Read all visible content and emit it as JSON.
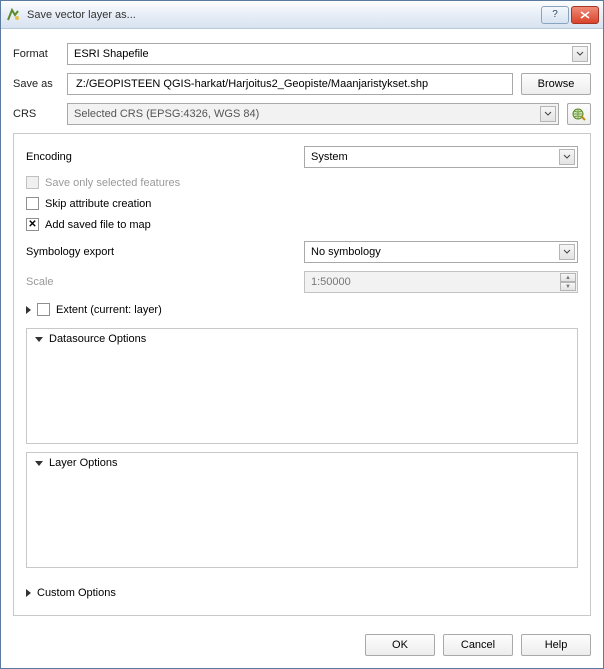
{
  "window": {
    "title": "Save vector layer as..."
  },
  "labels": {
    "format": "Format",
    "saveas": "Save as",
    "crs": "CRS",
    "encoding": "Encoding",
    "symbology": "Symbology export",
    "scale": "Scale"
  },
  "values": {
    "format": "ESRI Shapefile",
    "saveas": "Z:/GEOPISTEEN QGIS-harkat/Harjoitus2_Geopiste/Maanjaristykset.shp",
    "crs": "Selected CRS (EPSG:4326, WGS 84)",
    "encoding": "System",
    "symbology": "No symbology",
    "scale": "1:50000"
  },
  "buttons": {
    "browse": "Browse",
    "ok": "OK",
    "cancel": "Cancel",
    "help": "Help"
  },
  "checks": {
    "save_selected": {
      "label": "Save only selected features",
      "checked": false,
      "enabled": false
    },
    "skip_attr": {
      "label": "Skip attribute creation",
      "checked": false,
      "enabled": true
    },
    "add_to_map": {
      "label": "Add saved file to map",
      "checked": true,
      "enabled": true
    },
    "extent": {
      "label": "Extent (current: layer)",
      "checked": false,
      "enabled": true
    }
  },
  "sections": {
    "datasource": "Datasource Options",
    "layer": "Layer Options",
    "custom": "Custom Options"
  }
}
